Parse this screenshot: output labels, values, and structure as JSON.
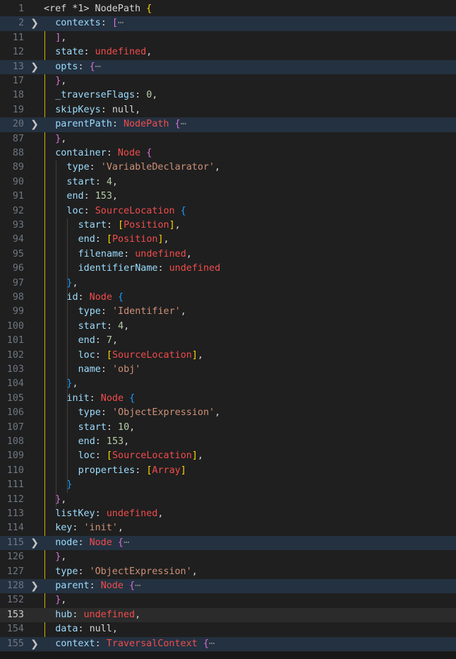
{
  "colors": {
    "background": "#1f1f1f",
    "key": "#9cdcfe",
    "plain": "#d4d4d4",
    "number": "#b5cea8",
    "string": "#ce9178",
    "type": "#f14c4c",
    "keyword": "#f14c4c",
    "brace_gold": "#ffd700",
    "brace_purple": "#da70d6",
    "brace_blue": "#179fff",
    "folded_bg": "#243140",
    "current_bg": "#2b2b2b"
  },
  "icons": {
    "fold_collapsed": "chevron-right-icon"
  },
  "lines": [
    {
      "num": "1",
      "indent": 0,
      "tokens": [
        [
          "plain",
          "<ref *1> NodePath "
        ],
        [
          "brace_gold",
          "{"
        ]
      ]
    },
    {
      "num": "2",
      "indent": 1,
      "folded": true,
      "tokens": [
        [
          "plain",
          "contexts: "
        ],
        [
          "brace_purple",
          "["
        ],
        [
          "ellipsis",
          "⋯"
        ]
      ]
    },
    {
      "num": "11",
      "indent": 1,
      "tokens": [
        [
          "brace_purple",
          "]"
        ],
        [
          "plain",
          ","
        ]
      ]
    },
    {
      "num": "12",
      "indent": 1,
      "tokens": [
        [
          "plain",
          "state: "
        ],
        [
          "keyword",
          "undefined"
        ],
        [
          "plain",
          ","
        ]
      ]
    },
    {
      "num": "13",
      "indent": 1,
      "folded": true,
      "tokens": [
        [
          "plain",
          "opts: "
        ],
        [
          "brace_purple",
          "{"
        ],
        [
          "ellipsis",
          "⋯"
        ]
      ]
    },
    {
      "num": "17",
      "indent": 1,
      "tokens": [
        [
          "brace_purple",
          "}"
        ],
        [
          "plain",
          ","
        ]
      ]
    },
    {
      "num": "18",
      "indent": 1,
      "tokens": [
        [
          "plain",
          "_traverseFlags: "
        ],
        [
          "number",
          "0"
        ],
        [
          "plain",
          ","
        ]
      ]
    },
    {
      "num": "19",
      "indent": 1,
      "tokens": [
        [
          "plain",
          "skipKeys: "
        ],
        [
          "plain",
          "null"
        ],
        [
          "plain",
          ","
        ]
      ]
    },
    {
      "num": "20",
      "indent": 1,
      "folded": true,
      "tokens": [
        [
          "plain",
          "parentPath: "
        ],
        [
          "type",
          "NodePath"
        ],
        [
          "plain",
          " "
        ],
        [
          "brace_purple",
          "{"
        ],
        [
          "ellipsis",
          "⋯"
        ]
      ]
    },
    {
      "num": "87",
      "indent": 1,
      "tokens": [
        [
          "brace_purple",
          "}"
        ],
        [
          "plain",
          ","
        ]
      ]
    },
    {
      "num": "88",
      "indent": 1,
      "tokens": [
        [
          "plain",
          "container: "
        ],
        [
          "type",
          "Node"
        ],
        [
          "plain",
          " "
        ],
        [
          "brace_purple",
          "{"
        ]
      ]
    },
    {
      "num": "89",
      "indent": 2,
      "tokens": [
        [
          "plain",
          "type: "
        ],
        [
          "string",
          "'VariableDeclarator'"
        ],
        [
          "plain",
          ","
        ]
      ]
    },
    {
      "num": "90",
      "indent": 2,
      "tokens": [
        [
          "plain",
          "start: "
        ],
        [
          "number",
          "4"
        ],
        [
          "plain",
          ","
        ]
      ]
    },
    {
      "num": "91",
      "indent": 2,
      "tokens": [
        [
          "plain",
          "end: "
        ],
        [
          "number",
          "153"
        ],
        [
          "plain",
          ","
        ]
      ]
    },
    {
      "num": "92",
      "indent": 2,
      "tokens": [
        [
          "plain",
          "loc: "
        ],
        [
          "type",
          "SourceLocation"
        ],
        [
          "plain",
          " "
        ],
        [
          "brace_blue",
          "{"
        ]
      ]
    },
    {
      "num": "93",
      "indent": 3,
      "tokens": [
        [
          "plain",
          "start: "
        ],
        [
          "brace_gold",
          "["
        ],
        [
          "type",
          "Position"
        ],
        [
          "brace_gold",
          "]"
        ],
        [
          "plain",
          ","
        ]
      ]
    },
    {
      "num": "94",
      "indent": 3,
      "tokens": [
        [
          "plain",
          "end: "
        ],
        [
          "brace_gold",
          "["
        ],
        [
          "type",
          "Position"
        ],
        [
          "brace_gold",
          "]"
        ],
        [
          "plain",
          ","
        ]
      ]
    },
    {
      "num": "95",
      "indent": 3,
      "tokens": [
        [
          "plain",
          "filename: "
        ],
        [
          "keyword",
          "undefined"
        ],
        [
          "plain",
          ","
        ]
      ]
    },
    {
      "num": "96",
      "indent": 3,
      "tokens": [
        [
          "plain",
          "identifierName: "
        ],
        [
          "keyword",
          "undefined"
        ]
      ]
    },
    {
      "num": "97",
      "indent": 2,
      "tokens": [
        [
          "brace_blue",
          "}"
        ],
        [
          "plain",
          ","
        ]
      ]
    },
    {
      "num": "98",
      "indent": 2,
      "tokens": [
        [
          "plain",
          "id: "
        ],
        [
          "type",
          "Node"
        ],
        [
          "plain",
          " "
        ],
        [
          "brace_blue",
          "{"
        ]
      ]
    },
    {
      "num": "99",
      "indent": 3,
      "tokens": [
        [
          "plain",
          "type: "
        ],
        [
          "string",
          "'Identifier'"
        ],
        [
          "plain",
          ","
        ]
      ]
    },
    {
      "num": "100",
      "indent": 3,
      "tokens": [
        [
          "plain",
          "start: "
        ],
        [
          "number",
          "4"
        ],
        [
          "plain",
          ","
        ]
      ]
    },
    {
      "num": "101",
      "indent": 3,
      "tokens": [
        [
          "plain",
          "end: "
        ],
        [
          "number",
          "7"
        ],
        [
          "plain",
          ","
        ]
      ]
    },
    {
      "num": "102",
      "indent": 3,
      "tokens": [
        [
          "plain",
          "loc: "
        ],
        [
          "brace_gold",
          "["
        ],
        [
          "type",
          "SourceLocation"
        ],
        [
          "brace_gold",
          "]"
        ],
        [
          "plain",
          ","
        ]
      ]
    },
    {
      "num": "103",
      "indent": 3,
      "tokens": [
        [
          "plain",
          "name: "
        ],
        [
          "string",
          "'obj'"
        ]
      ]
    },
    {
      "num": "104",
      "indent": 2,
      "tokens": [
        [
          "brace_blue",
          "}"
        ],
        [
          "plain",
          ","
        ]
      ]
    },
    {
      "num": "105",
      "indent": 2,
      "tokens": [
        [
          "plain",
          "init: "
        ],
        [
          "type",
          "Node"
        ],
        [
          "plain",
          " "
        ],
        [
          "brace_blue",
          "{"
        ]
      ]
    },
    {
      "num": "106",
      "indent": 3,
      "tokens": [
        [
          "plain",
          "type: "
        ],
        [
          "string",
          "'ObjectExpression'"
        ],
        [
          "plain",
          ","
        ]
      ]
    },
    {
      "num": "107",
      "indent": 3,
      "tokens": [
        [
          "plain",
          "start: "
        ],
        [
          "number",
          "10"
        ],
        [
          "plain",
          ","
        ]
      ]
    },
    {
      "num": "108",
      "indent": 3,
      "tokens": [
        [
          "plain",
          "end: "
        ],
        [
          "number",
          "153"
        ],
        [
          "plain",
          ","
        ]
      ]
    },
    {
      "num": "109",
      "indent": 3,
      "tokens": [
        [
          "plain",
          "loc: "
        ],
        [
          "brace_gold",
          "["
        ],
        [
          "type",
          "SourceLocation"
        ],
        [
          "brace_gold",
          "]"
        ],
        [
          "plain",
          ","
        ]
      ]
    },
    {
      "num": "110",
      "indent": 3,
      "tokens": [
        [
          "plain",
          "properties: "
        ],
        [
          "brace_gold",
          "["
        ],
        [
          "type",
          "Array"
        ],
        [
          "brace_gold",
          "]"
        ]
      ]
    },
    {
      "num": "111",
      "indent": 2,
      "tokens": [
        [
          "brace_blue",
          "}"
        ]
      ]
    },
    {
      "num": "112",
      "indent": 1,
      "tokens": [
        [
          "brace_purple",
          "}"
        ],
        [
          "plain",
          ","
        ]
      ]
    },
    {
      "num": "113",
      "indent": 1,
      "tokens": [
        [
          "plain",
          "listKey: "
        ],
        [
          "keyword",
          "undefined"
        ],
        [
          "plain",
          ","
        ]
      ]
    },
    {
      "num": "114",
      "indent": 1,
      "tokens": [
        [
          "plain",
          "key: "
        ],
        [
          "string",
          "'init'"
        ],
        [
          "plain",
          ","
        ]
      ]
    },
    {
      "num": "115",
      "indent": 1,
      "folded": true,
      "tokens": [
        [
          "plain",
          "node: "
        ],
        [
          "type",
          "Node"
        ],
        [
          "plain",
          " "
        ],
        [
          "brace_purple",
          "{"
        ],
        [
          "ellipsis",
          "⋯"
        ]
      ]
    },
    {
      "num": "126",
      "indent": 1,
      "tokens": [
        [
          "brace_purple",
          "}"
        ],
        [
          "plain",
          ","
        ]
      ]
    },
    {
      "num": "127",
      "indent": 1,
      "tokens": [
        [
          "plain",
          "type: "
        ],
        [
          "string",
          "'ObjectExpression'"
        ],
        [
          "plain",
          ","
        ]
      ]
    },
    {
      "num": "128",
      "indent": 1,
      "folded": true,
      "tokens": [
        [
          "plain",
          "parent: "
        ],
        [
          "type",
          "Node"
        ],
        [
          "plain",
          " "
        ],
        [
          "brace_purple",
          "{"
        ],
        [
          "ellipsis",
          "⋯"
        ]
      ]
    },
    {
      "num": "152",
      "indent": 1,
      "tokens": [
        [
          "brace_purple",
          "}"
        ],
        [
          "plain",
          ","
        ]
      ]
    },
    {
      "num": "153",
      "indent": 1,
      "current": true,
      "tokens": [
        [
          "plain",
          "hub: "
        ],
        [
          "keyword",
          "undefined"
        ],
        [
          "plain",
          ","
        ]
      ]
    },
    {
      "num": "154",
      "indent": 1,
      "tokens": [
        [
          "plain",
          "data: "
        ],
        [
          "plain",
          "null"
        ],
        [
          "plain",
          ","
        ]
      ]
    },
    {
      "num": "155",
      "indent": 1,
      "folded": true,
      "tokens": [
        [
          "plain",
          "context: "
        ],
        [
          "type",
          "TraversalContext"
        ],
        [
          "plain",
          " "
        ],
        [
          "brace_purple",
          "{"
        ],
        [
          "ellipsis",
          "⋯"
        ]
      ]
    }
  ]
}
